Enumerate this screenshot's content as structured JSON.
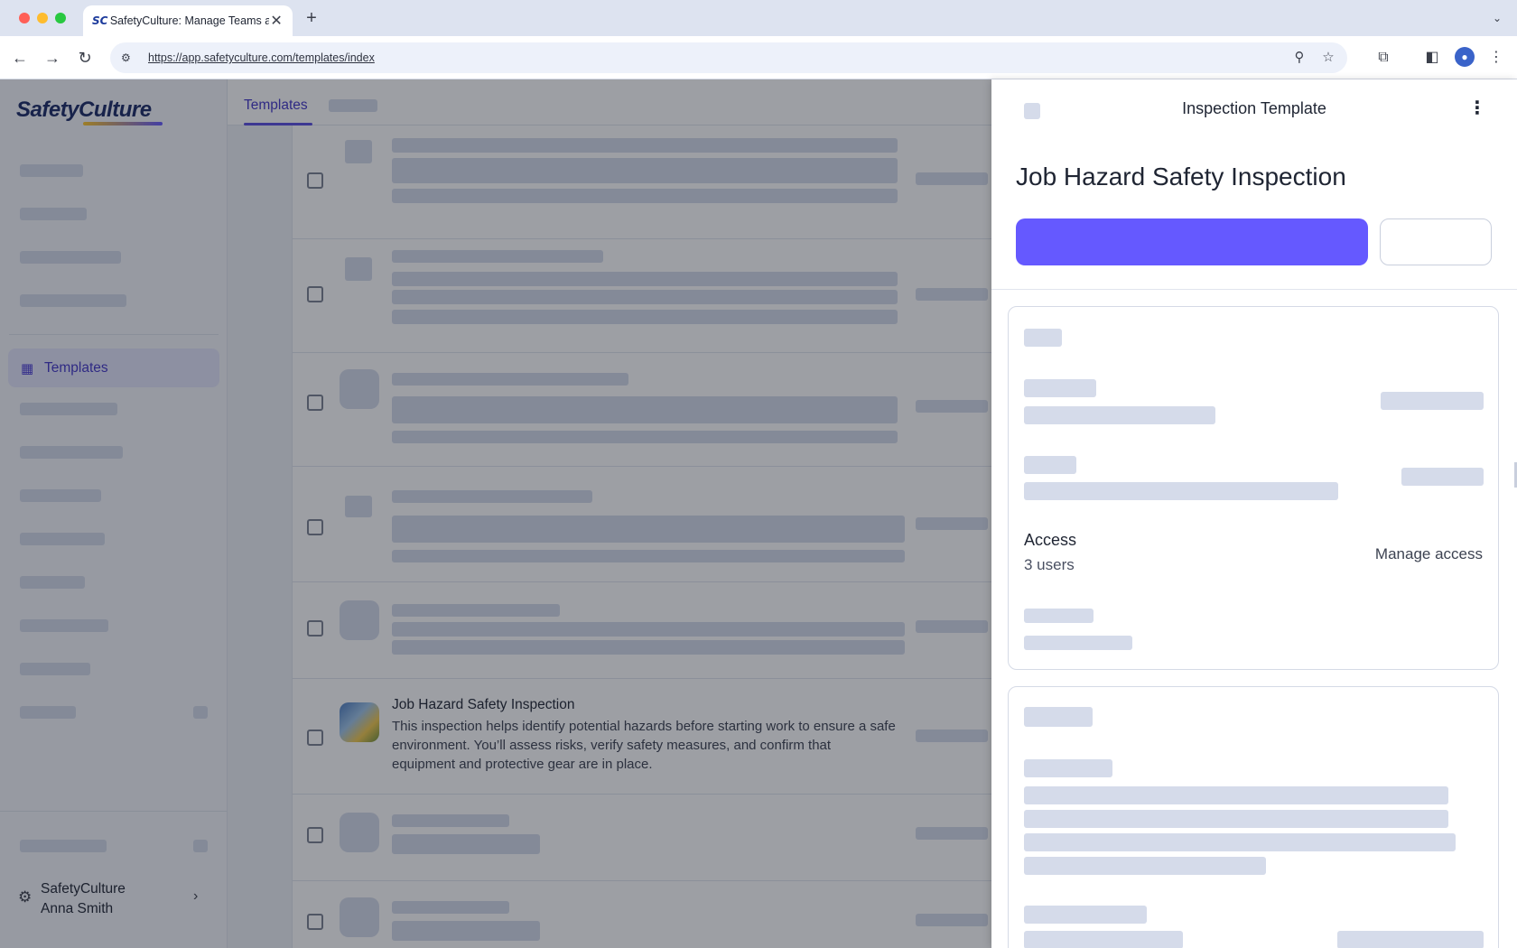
{
  "browser": {
    "tab_title": "SafetyCulture: Manage Teams and...",
    "favicon_text": "SC",
    "tab_close": "✕",
    "new_tab": "+",
    "tab_menu": "⌄",
    "url": "https://app.safetyculture.com/templates/index",
    "icons": {
      "back": "←",
      "forward": "→",
      "reload": "↻",
      "site_info": "⚙",
      "zoom": "⚲",
      "bookmark": "☆",
      "extensions": "⧉",
      "sidebar": "◧",
      "profile": "●",
      "menu": "⋮"
    }
  },
  "sidebar": {
    "logo": "SafetyCulture",
    "active_item": {
      "label": "Templates",
      "icon": "▦"
    },
    "user": {
      "org": "SafetyCulture",
      "name": "Anna Smith",
      "gear": "⚙",
      "chevron": "›"
    }
  },
  "main": {
    "tabs": [
      {
        "label": "Templates"
      }
    ],
    "featured_row": {
      "title": "Job Hazard Safety Inspection",
      "description": "This inspection helps identify potential hazards before starting work to ensure a safe environment. You’ll assess risks, verify safety measures, and confirm that equipment and protective gear are in place."
    }
  },
  "panel": {
    "header_title": "Inspection Template",
    "more_icon": "⋮",
    "title": "Job Hazard Safety Inspection",
    "access": {
      "label": "Access",
      "count": "3 users",
      "manage_label": "Manage access"
    }
  },
  "colors": {
    "brand": "#6559ff",
    "active_nav_text": "#4336c9",
    "skeleton": "#d5dbea"
  }
}
